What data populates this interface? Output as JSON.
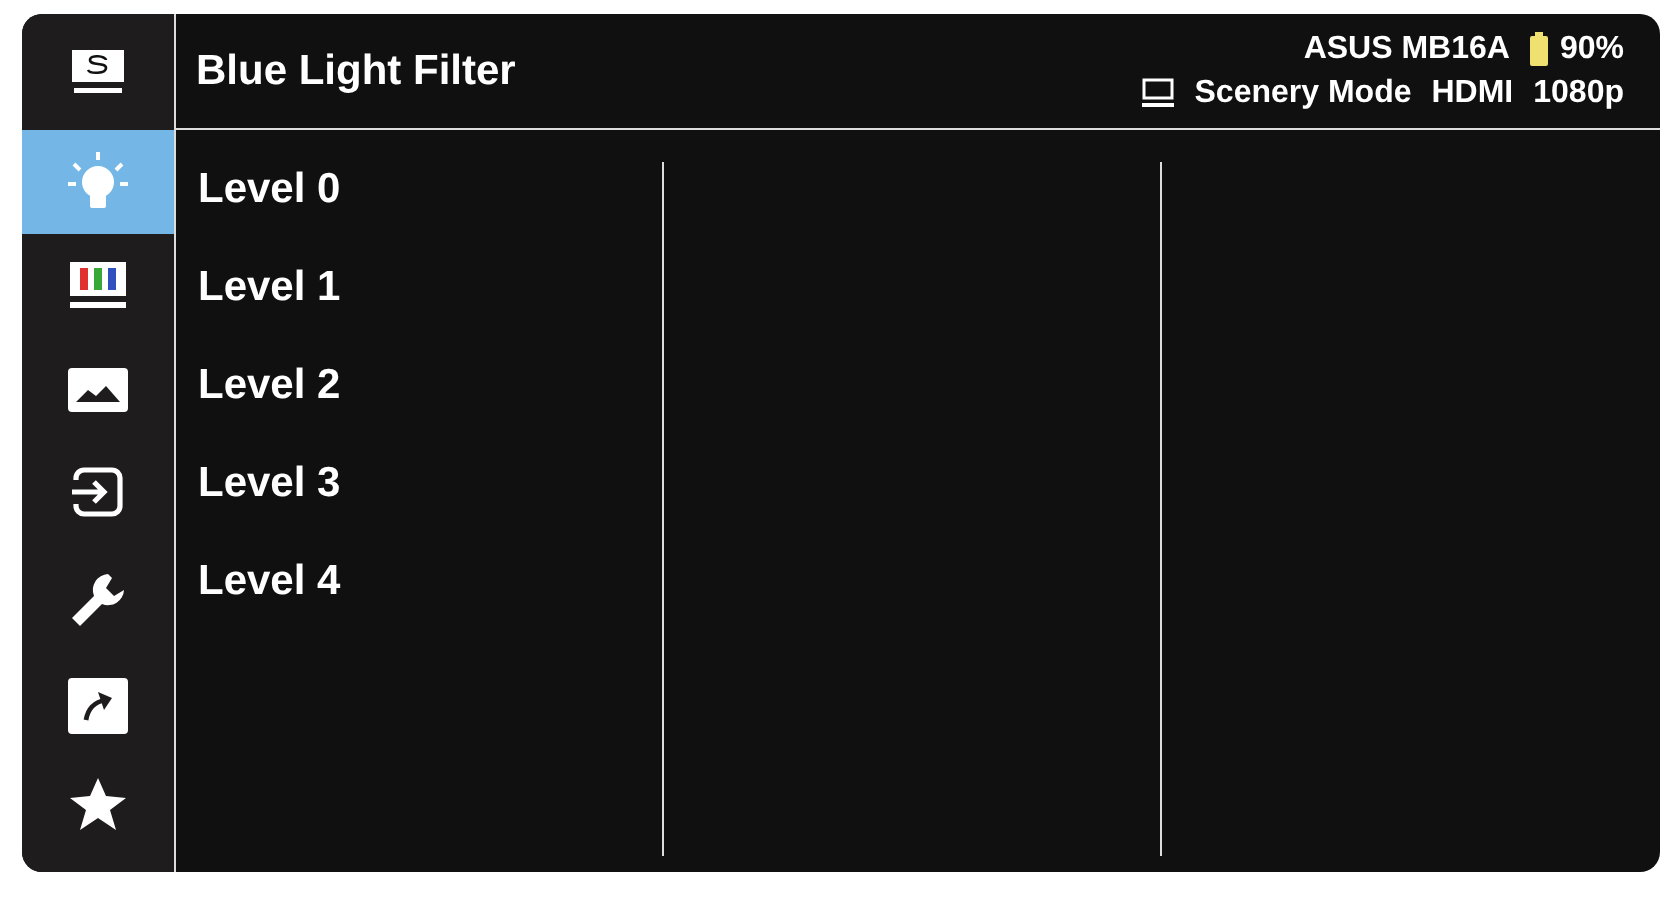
{
  "header": {
    "title": "Blue Light Filter",
    "model": "ASUS MB16A",
    "battery": "90%",
    "mode": "Scenery Mode",
    "input": "HDMI",
    "resolution": "1080p"
  },
  "sidebar": {
    "items": [
      {
        "kind": "splendid",
        "selected": false
      },
      {
        "kind": "bluelight",
        "selected": true
      },
      {
        "kind": "color",
        "selected": false
      },
      {
        "kind": "image",
        "selected": false
      },
      {
        "kind": "input",
        "selected": false
      },
      {
        "kind": "system",
        "selected": false
      },
      {
        "kind": "shortcut",
        "selected": false
      },
      {
        "kind": "favorite",
        "selected": false
      }
    ]
  },
  "options": [
    {
      "label": "Level 0"
    },
    {
      "label": "Level 1"
    },
    {
      "label": "Level 2"
    },
    {
      "label": "Level 3"
    },
    {
      "label": "Level 4"
    }
  ]
}
